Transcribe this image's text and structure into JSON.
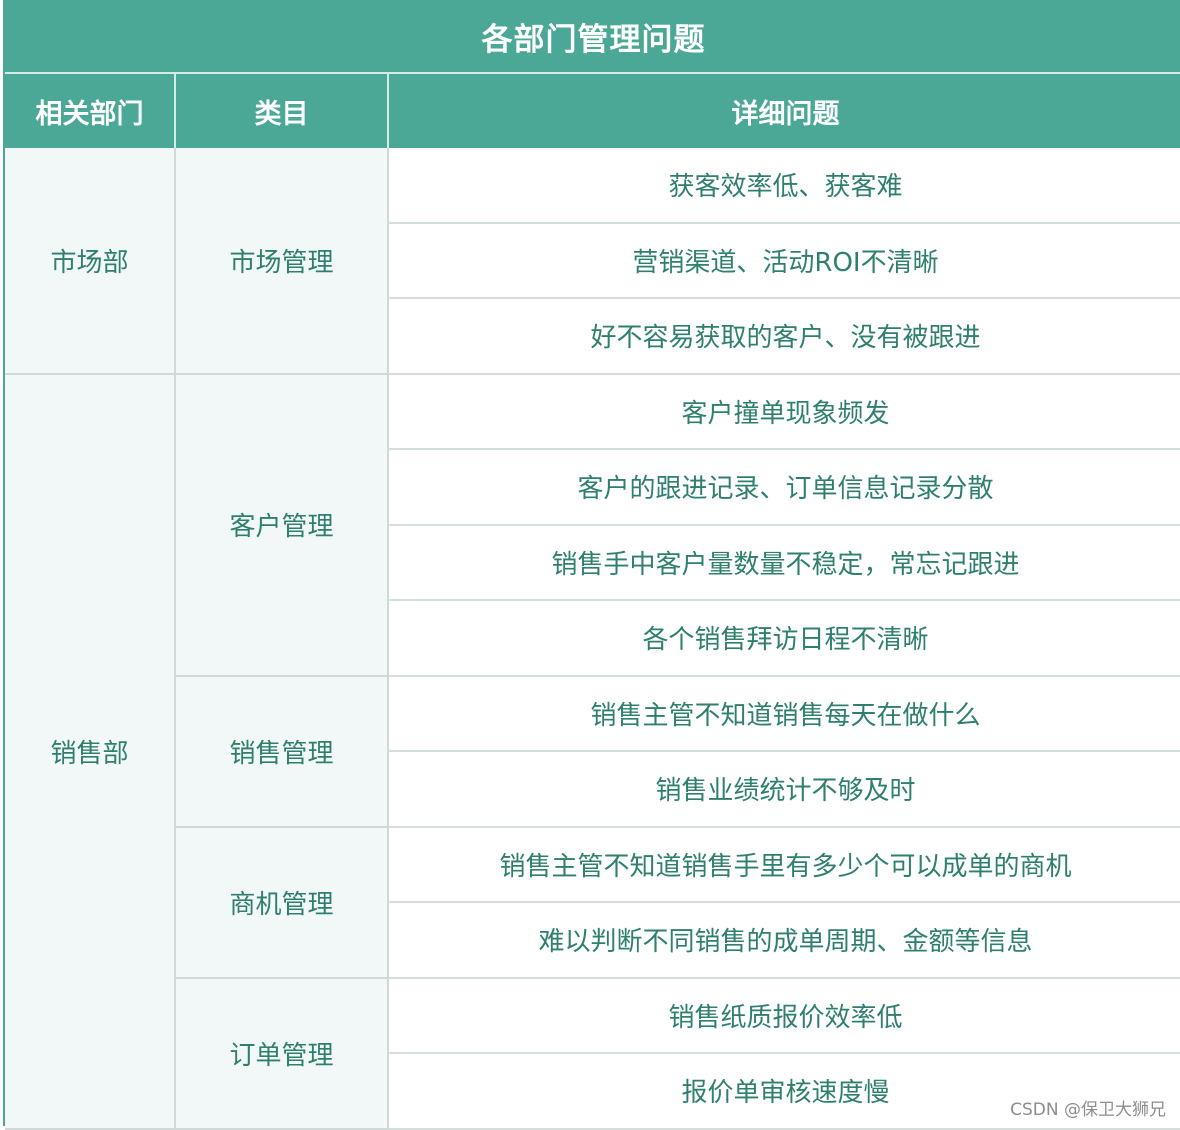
{
  "table": {
    "title": "各部门管理问题",
    "headers": [
      "相关部门",
      "类目",
      "详细问题"
    ],
    "departments": [
      {
        "name": "市场部",
        "categories": [
          {
            "name": "市场管理",
            "issues": [
              "获客效率低、获客难",
              "营销渠道、活动ROI不清晰",
              "好不容易获取的客户、没有被跟进"
            ]
          }
        ]
      },
      {
        "name": "销售部",
        "categories": [
          {
            "name": "客户管理",
            "issues": [
              "客户撞单现象频发",
              "客户的跟进记录、订单信息记录分散",
              "销售手中客户量数量不稳定，常忘记跟进",
              "各个销售拜访日程不清晰"
            ]
          },
          {
            "name": "销售管理",
            "issues": [
              "销售主管不知道销售每天在做什么",
              "销售业绩统计不够及时"
            ]
          },
          {
            "name": "商机管理",
            "issues": [
              "销售主管不知道销售手里有多少个可以成单的商机",
              "难以判断不同销售的成单周期、金额等信息"
            ]
          },
          {
            "name": "订单管理",
            "issues": [
              "销售纸质报价效率低",
              "报价单审核速度慢"
            ]
          }
        ]
      }
    ]
  },
  "watermark": "CSDN @保卫大狮兄",
  "colors": {
    "header_bg": "#4ba896",
    "text": "#2f7f70",
    "side_bg": "#f2f8f7"
  }
}
